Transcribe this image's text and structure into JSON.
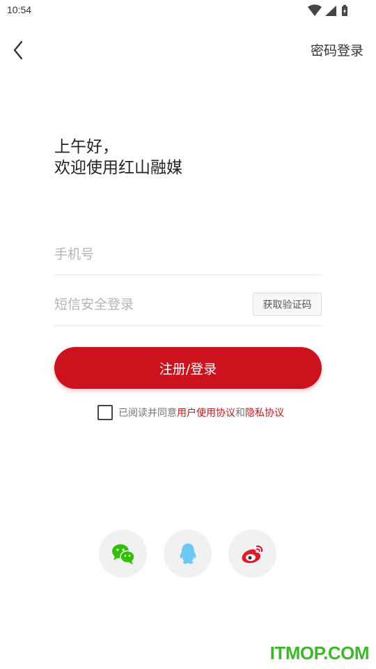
{
  "status_bar": {
    "time": "10:54",
    "icons": [
      "wifi-icon",
      "cellular-signal-icon",
      "battery-charging-icon"
    ]
  },
  "nav": {
    "back_icon": "chevron-left-icon",
    "password_login_label": "密码登录"
  },
  "greeting": {
    "line1": "上午好，",
    "line2": "欢迎使用红山融媒"
  },
  "form": {
    "phone_placeholder": "手机号",
    "phone_value": "",
    "code_placeholder": "短信安全登录",
    "code_value": "",
    "get_code_label": "获取验证码",
    "submit_label": "注册/登录"
  },
  "agreement": {
    "checked": false,
    "prefix": "已阅读并同意",
    "user_agreement": "用户使用协议",
    "conjunction": "和",
    "privacy_agreement": "隐私协议"
  },
  "social": {
    "items": [
      "wechat-icon",
      "qq-icon",
      "weibo-icon"
    ]
  },
  "watermark": "ITMOP.COM",
  "colors": {
    "accent": "#cc131d",
    "wechat": "#2dc100",
    "qq": "#6cc8f2",
    "weibo": "#e6162d"
  }
}
